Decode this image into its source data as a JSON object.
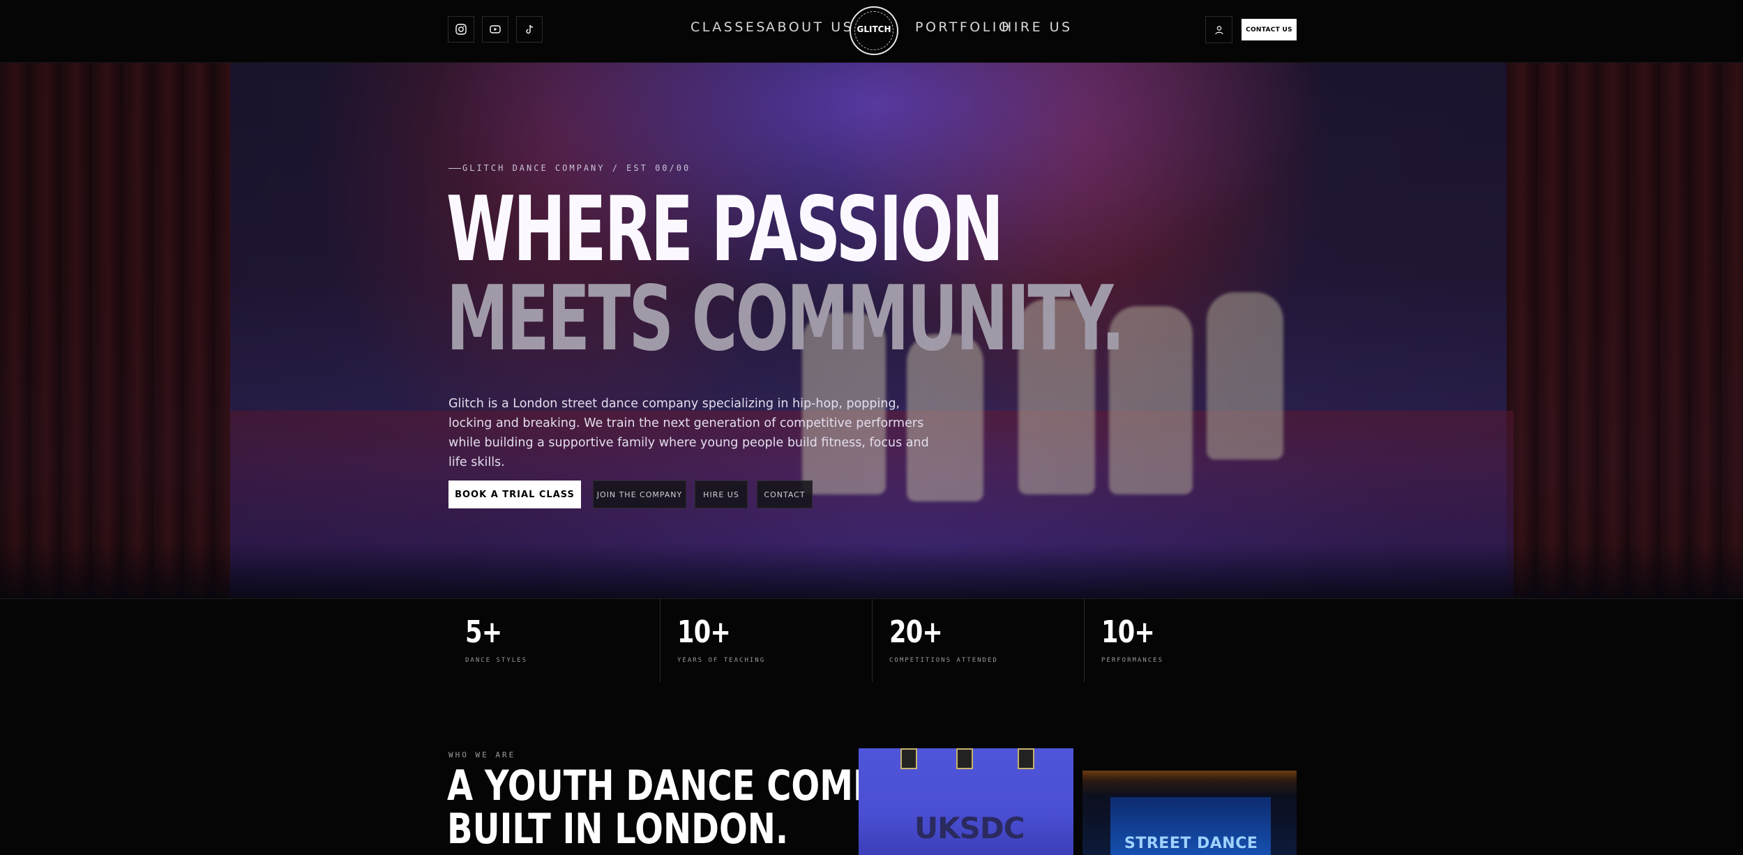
{
  "header": {
    "nav_left": [
      "CLASSES",
      "ABOUT US"
    ],
    "nav_right": [
      "PORTFOLIO",
      "HIRE US"
    ],
    "logo_text": "GLITCH",
    "contact_button": "CONTACT US",
    "social_icons": [
      "instagram-icon",
      "youtube-icon",
      "tiktok-icon"
    ],
    "account_icon": "user-icon"
  },
  "hero": {
    "eyebrow": "GLITCH DANCE COMPANY / EST 00/00",
    "headline_line1": "WHERE PASSION",
    "headline_line2": "MEETS COMMUNITY.",
    "description": "Glitch is a London street dance company specializing in hip-hop, popping, locking and breaking. We train the next generation of competitive performers while building a supportive family where young people build fitness, focus and life skills.",
    "buttons": {
      "primary": "BOOK A TRIAL CLASS",
      "join": "JOIN THE COMPANY",
      "hire": "HIRE US",
      "contact": "CONTACT"
    }
  },
  "stats": [
    {
      "value": "5+",
      "label": "DANCE STYLES"
    },
    {
      "value": "10+",
      "label": "YEARS OF TEACHING"
    },
    {
      "value": "20+",
      "label": "COMPETITIONS ATTENDED"
    },
    {
      "value": "10+",
      "label": "PERFORMANCES"
    }
  ],
  "about": {
    "eyebrow": "WHO WE ARE",
    "title_line1": "A YOUTH DANCE COMPANY",
    "title_line2": "BUILT IN LONDON.",
    "photo1_text": "UKSDC",
    "photo2_text": "STREET DANCE"
  },
  "colors": {
    "background": "#050505",
    "accent": "#ffffff",
    "headline_muted": "#a09aa8"
  }
}
